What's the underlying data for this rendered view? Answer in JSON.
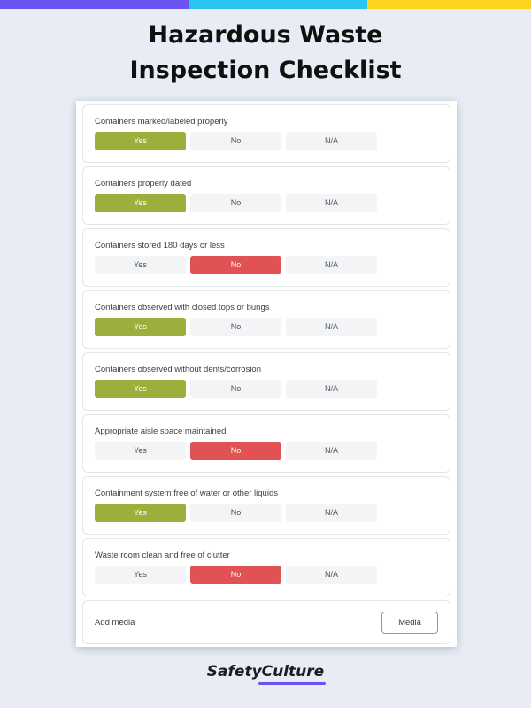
{
  "colors": {
    "stripe": [
      "#6b54f0",
      "#29c5f0",
      "#ffd21e"
    ],
    "yes_selected": "#9bb03c",
    "no_selected": "#e05254",
    "brand_accent": "#6b4ff0"
  },
  "header": {
    "title_line1": "Hazardous Waste",
    "title_line2": "Inspection Checklist"
  },
  "checklist": {
    "options": [
      "Yes",
      "No",
      "N/A"
    ],
    "items": [
      {
        "label": "Containers marked/labeled properly",
        "selected": "Yes"
      },
      {
        "label": "Containers properly dated",
        "selected": "Yes"
      },
      {
        "label": "Containers stored 180 days or less",
        "selected": "No"
      },
      {
        "label": "Containers observed with closed tops or bungs",
        "selected": "Yes"
      },
      {
        "label": "Containers observed without dents/corrosion",
        "selected": "Yes"
      },
      {
        "label": "Appropriate aisle space maintained",
        "selected": "No"
      },
      {
        "label": "Containment system free of water or other liquids",
        "selected": "Yes"
      },
      {
        "label": "Waste room clean and free of clutter",
        "selected": "No"
      }
    ]
  },
  "media": {
    "label": "Add media",
    "button_label": "Media"
  },
  "footer": {
    "brand": "SafetyCulture"
  }
}
